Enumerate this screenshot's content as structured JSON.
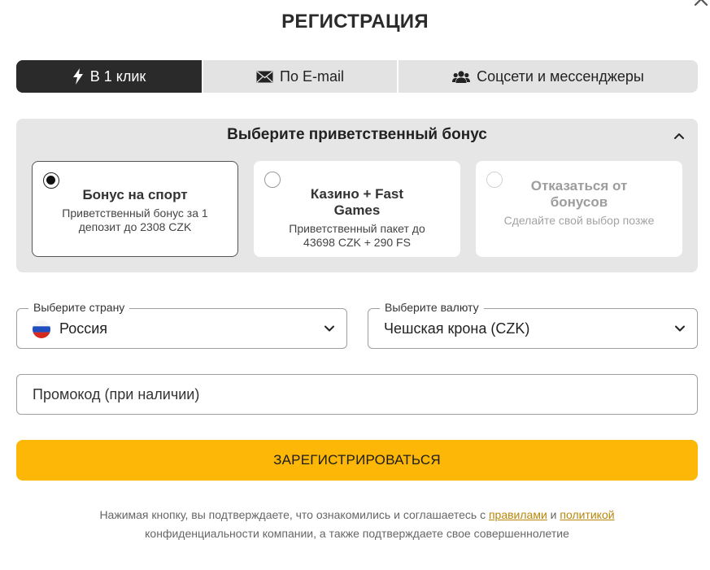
{
  "modal": {
    "title": "РЕГИСТРАЦИЯ",
    "close_icon": "close-icon"
  },
  "tabs": [
    {
      "label": "В 1 клик",
      "icon": "lightning-icon",
      "active": true
    },
    {
      "label": "По E-mail",
      "icon": "envelope-icon",
      "active": false
    },
    {
      "label": "Соцсети и мессенджеры",
      "icon": "users-icon",
      "active": false
    }
  ],
  "bonus": {
    "heading": "Выберите приветственный бонус",
    "options": [
      {
        "title": "Бонус на спорт",
        "description": "Приветственный бонус за 1 депозит до 2308 CZK",
        "selected": true
      },
      {
        "title": "Казино + Fast Games",
        "description": "Приветственный пакет до 43698 CZK + 290 FS",
        "selected": false
      },
      {
        "title": "Отказаться от бонусов",
        "description": "Сделайте свой выбор позже",
        "selected": false
      }
    ]
  },
  "country": {
    "label": "Выберите страну",
    "value": "Россия",
    "flag": "russia-flag"
  },
  "currency": {
    "label": "Выберите валюту",
    "value": "Чешская крона (CZK)"
  },
  "promo": {
    "placeholder": "Промокод (при наличии)",
    "value": ""
  },
  "submit": {
    "label": "ЗАРЕГИСТРИРОВАТЬСЯ"
  },
  "legal": {
    "text_before": "Нажимая кнопку, вы подтверждаете, что ознакомились и соглашаетесь с",
    "link_rules": "правилами",
    "and": "и",
    "link_policy": "политикой",
    "text_after": "конфиденциальности компании, а также подтверждаете свое совершеннолетие"
  },
  "colors": {
    "accent": "#fcb707",
    "tab_active": "#2a2a2a",
    "panel": "#e6e6e6",
    "link": "#b8860b"
  }
}
